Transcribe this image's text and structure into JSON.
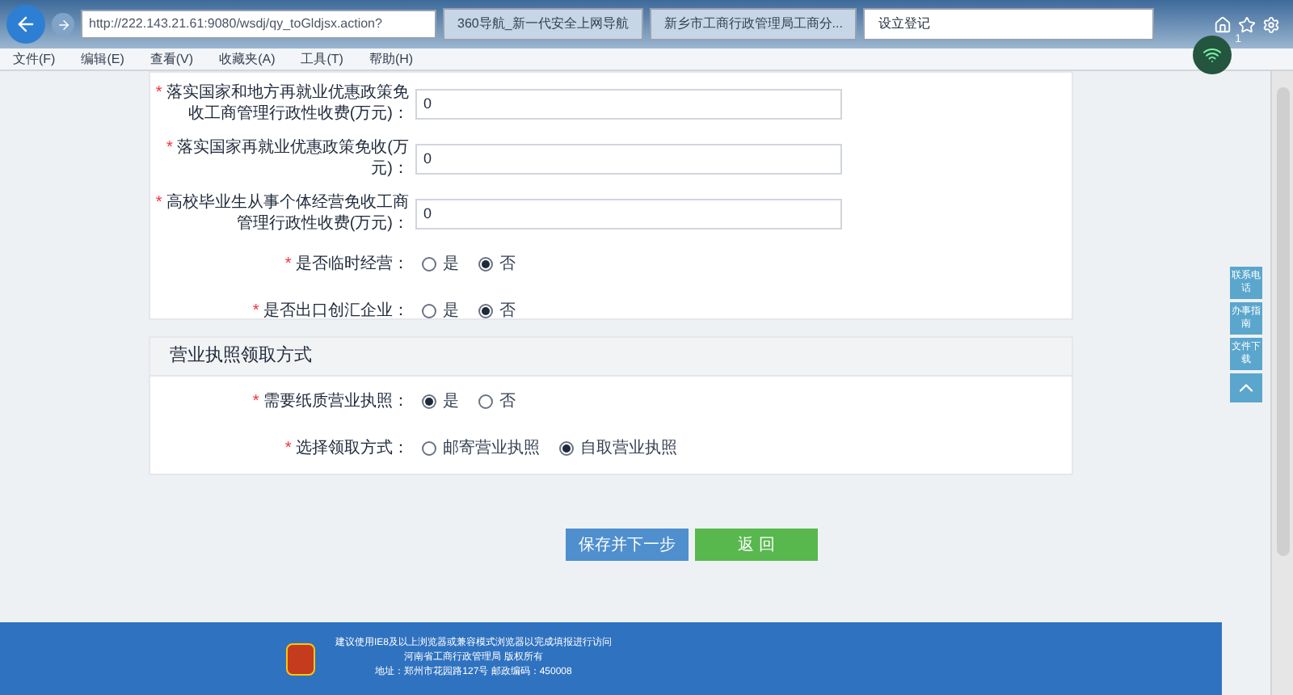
{
  "browser": {
    "url": "http://222.143.21.61:9080/wsdj/qy_toGldjsx.action?",
    "tabs": [
      {
        "label": "360导航_新一代安全上网导航",
        "selected": false
      },
      {
        "label": "新乡市工商行政管理局工商分...",
        "selected": false
      },
      {
        "label": "设立登记",
        "selected": true
      }
    ],
    "menu": [
      "文件(F)",
      "编辑(E)",
      "查看(V)",
      "收藏夹(A)",
      "工具(T)",
      "帮助(H)"
    ],
    "badge": "1"
  },
  "fee_section": {
    "fields": [
      {
        "kind": "text",
        "mark": "*",
        "label": "落实国家和地方再就业优惠政策免收工商管理行政性收费(万元)：",
        "value": "0"
      },
      {
        "kind": "text",
        "mark": "*",
        "label": "落实国家再就业优惠政策免收(万元)：",
        "value": "0"
      },
      {
        "kind": "text",
        "mark": "*",
        "label": "高校毕业生从事个体经营免收工商管理行政性收费(万元)：",
        "value": "0"
      },
      {
        "kind": "radio",
        "mark": "*",
        "label": "是否临时经营：",
        "options": [
          {
            "label": "是",
            "selected": false
          },
          {
            "label": "否",
            "selected": true
          }
        ]
      },
      {
        "kind": "radio",
        "mark": "*",
        "label": "是否出口创汇企业：",
        "options": [
          {
            "label": "是",
            "selected": false
          },
          {
            "label": "否",
            "selected": true
          }
        ]
      }
    ]
  },
  "license_section": {
    "title": "营业执照领取方式",
    "fields": [
      {
        "kind": "radio",
        "mark": "*",
        "label": "需要纸质营业执照：",
        "options": [
          {
            "label": "是",
            "selected": true
          },
          {
            "label": "否",
            "selected": false
          }
        ]
      },
      {
        "kind": "radio",
        "mark": "*",
        "label": "选择领取方式：",
        "options": [
          {
            "label": "邮寄营业执照",
            "selected": false
          },
          {
            "label": "自取营业执照",
            "selected": true
          }
        ]
      }
    ]
  },
  "buttons": [
    {
      "kind": "primary",
      "label": "保存并下一步"
    },
    {
      "kind": "secondary",
      "label": "返 回"
    }
  ],
  "side_buttons": [
    "联系电话",
    "办事指南",
    "文件下载"
  ],
  "footer": {
    "lines": [
      "建议使用IE8及以上浏览器或兼容模式浏览器以完成填报进行访问",
      "河南省工商行政管理局 版权所有",
      "地址：郑州市花园路127号 邮政编码：450008"
    ]
  }
}
